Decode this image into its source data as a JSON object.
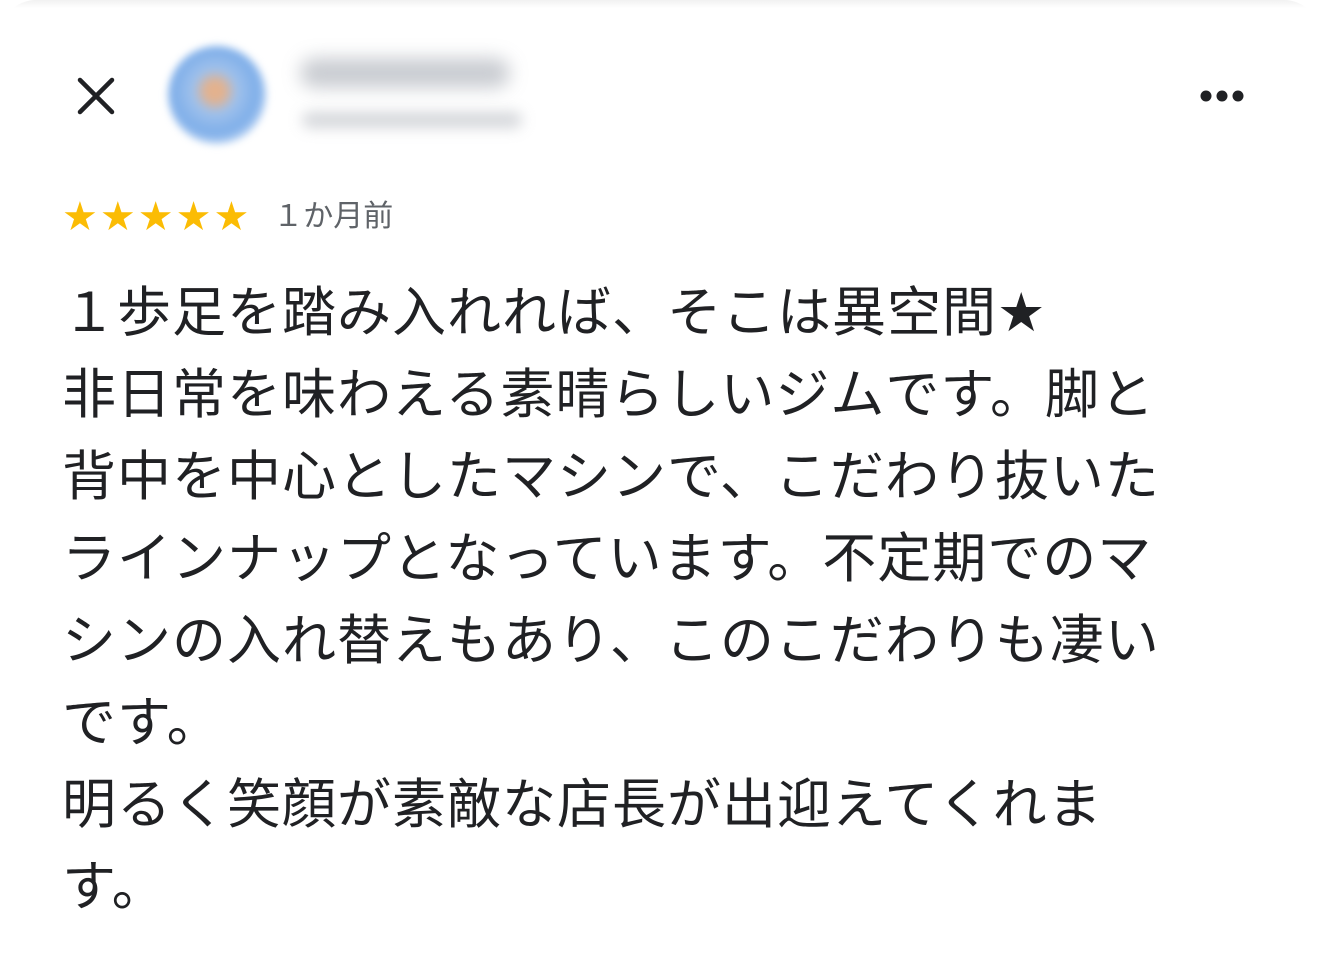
{
  "header": {
    "close_icon": "close-icon",
    "avatar_icon": "avatar",
    "reviewer_name": "",
    "reviewer_meta": "",
    "more_icon": "more-horizontal-icon"
  },
  "review": {
    "rating": 5,
    "rating_max": 5,
    "star_glyph": "★",
    "star_color": "#fbbc04",
    "time": "１か月前",
    "lines": [
      "１歩足を踏み入れれば、そこは異空間★",
      "非日常を味わえる素晴らしいジムです。脚と",
      "背中を中心としたマシンで、こだわり抜いた",
      "ラインナップとなっています。不定期でのマ",
      "シンの入れ替えもあり、このこだわりも凄い",
      "です。",
      "明るく笑顔が素敵な店長が出迎えてくれま",
      "す。"
    ]
  }
}
